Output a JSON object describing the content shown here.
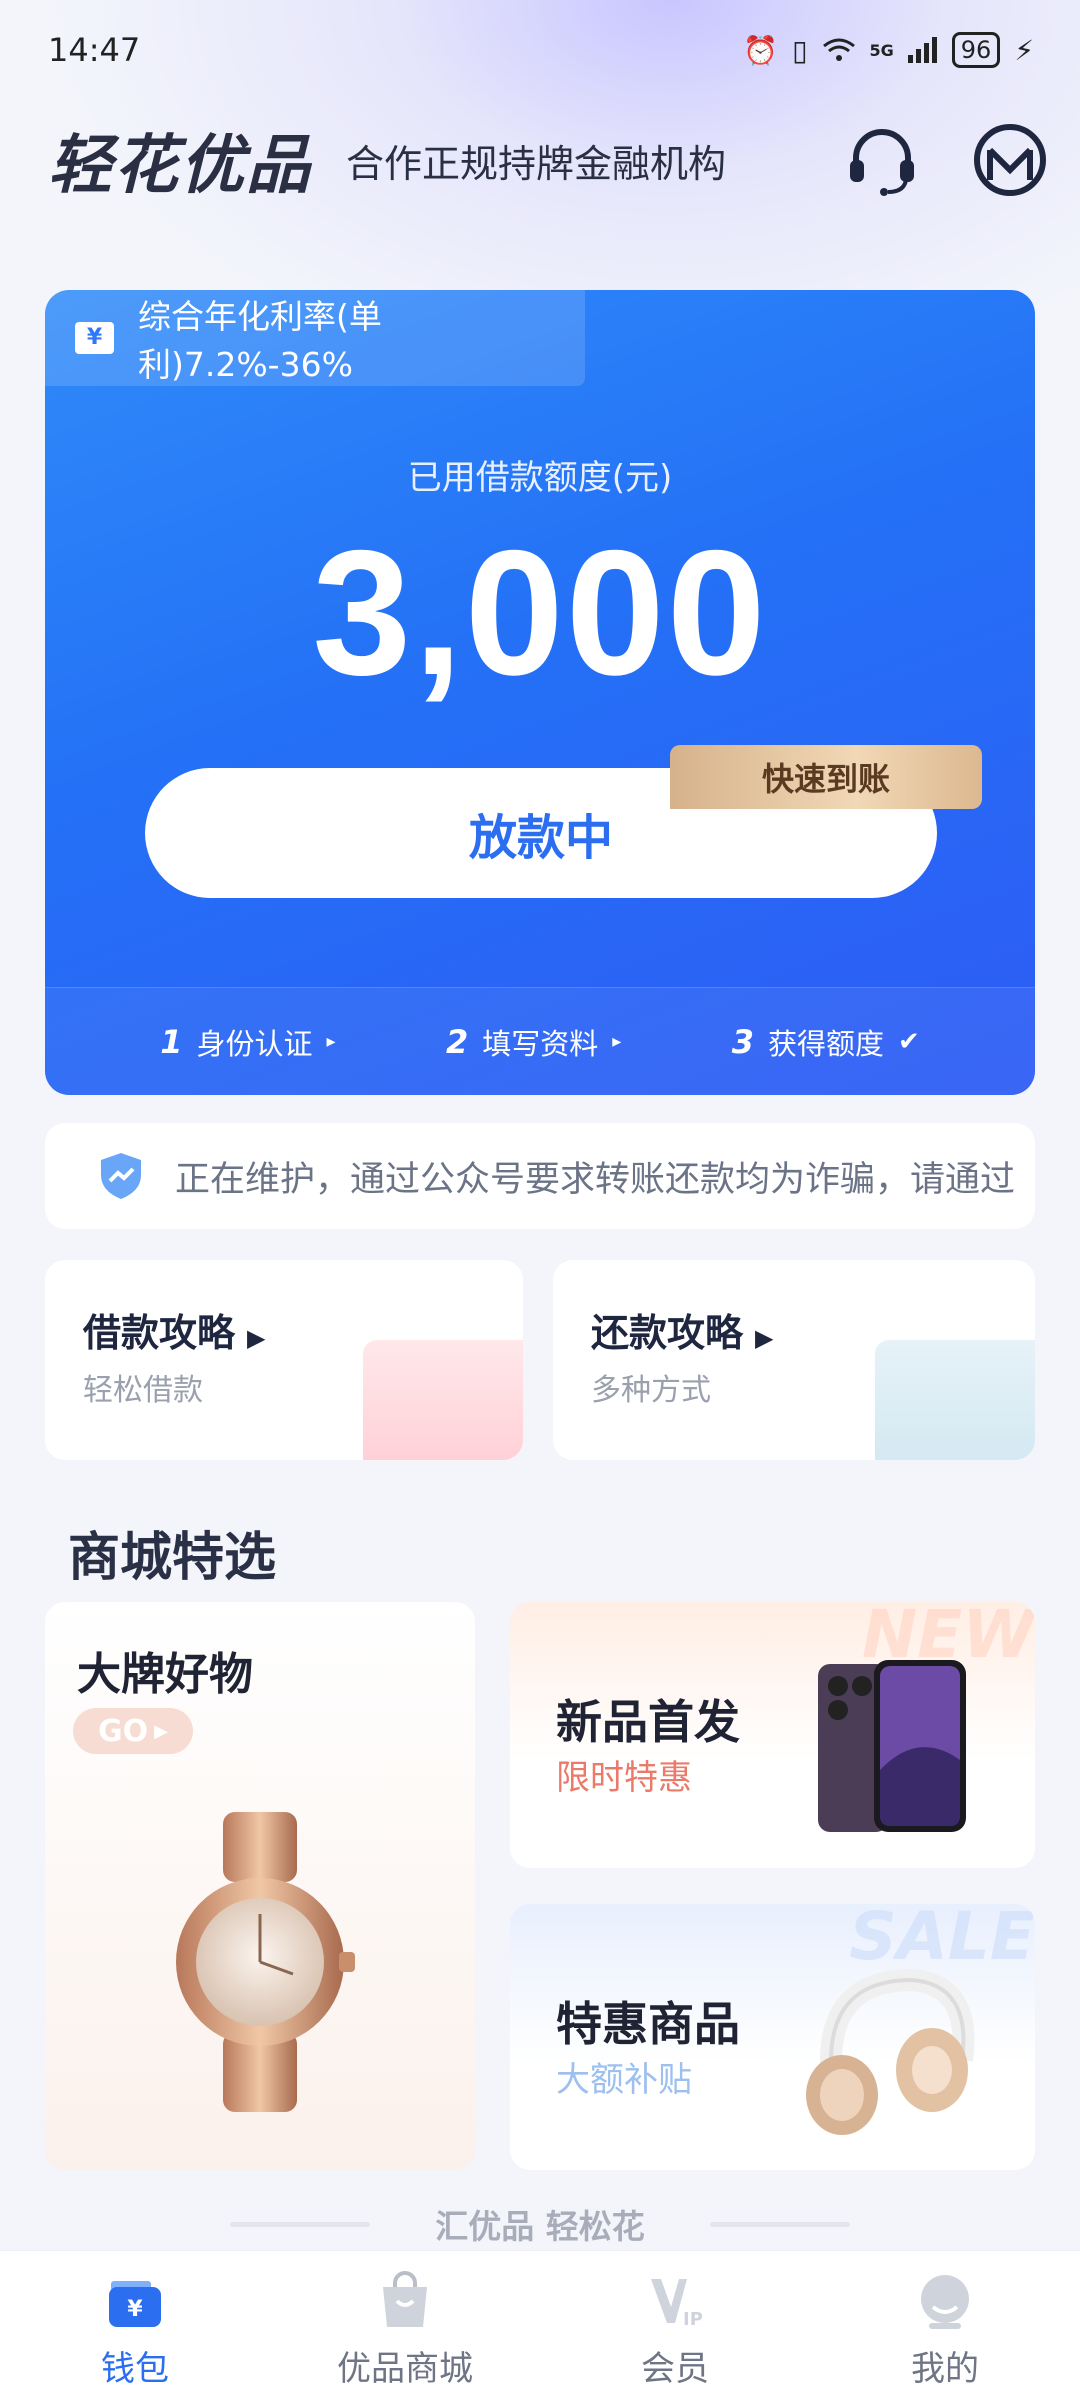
{
  "status_bar": {
    "time": "14:47",
    "network": "5G",
    "battery": "96"
  },
  "header": {
    "logo": "轻花优品",
    "subtitle": "合作正规持牌金融机构"
  },
  "loan_card": {
    "rate_text": "综合年化利率(单利)7.2%-36%",
    "amount_label": "已用借款额度(元)",
    "amount": "3,000",
    "button_label": "放款中",
    "badge_label": "快速到账",
    "steps": [
      {
        "num": "1",
        "label": "身份认证",
        "marker": "▸"
      },
      {
        "num": "2",
        "label": "填写资料",
        "marker": "▸"
      },
      {
        "num": "3",
        "label": "获得额度",
        "marker": "✔"
      }
    ]
  },
  "notice": {
    "text": "正在维护，通过公众号要求转账还款均为诈骗，请通过"
  },
  "guides": [
    {
      "title": "借款攻略",
      "subtitle": "轻松借款"
    },
    {
      "title": "还款攻略",
      "subtitle": "多种方式"
    }
  ],
  "mall": {
    "section_title": "商城特选",
    "big_card": {
      "title": "大牌好物",
      "go": "GO"
    },
    "new_card": {
      "title": "新品首发",
      "subtitle": "限时特惠",
      "watermark": "NEW"
    },
    "sale_card": {
      "title": "特惠商品",
      "subtitle": "大额补贴",
      "watermark": "SALE"
    }
  },
  "tagline": "汇优品 轻松花",
  "bottom_nav": [
    {
      "label": "钱包"
    },
    {
      "label": "优品商城"
    },
    {
      "label": "会员"
    },
    {
      "label": "我的"
    }
  ],
  "colors": {
    "primary": "#2b6ef0",
    "card_gradient_start": "#2f8bf9",
    "card_gradient_end": "#2e5cf5",
    "badge_gold": "#e3c49e"
  }
}
